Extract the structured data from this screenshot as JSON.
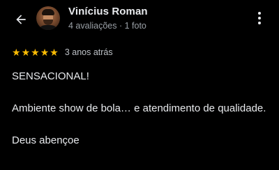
{
  "header": {
    "back_icon": "arrow-left-icon",
    "avatar_icon": "user-avatar-photo",
    "reviewer_name": "Vinícius Roman",
    "reviewer_meta": "4 avaliações · 1 foto",
    "more_icon": "more-vertical-icon"
  },
  "rating": {
    "stars": 5,
    "max_stars": 5,
    "star_glyph": "★",
    "star_color": "#fbbc04",
    "date": "3 anos atrás"
  },
  "review": {
    "paragraphs": [
      "SENSACIONAL!",
      "Ambiente show de bola… e atendimento de qualidade.",
      "Deus abençoe"
    ]
  },
  "colors": {
    "background": "#000000",
    "text_primary": "#e8eaed",
    "text_secondary": "#9aa0a6"
  }
}
